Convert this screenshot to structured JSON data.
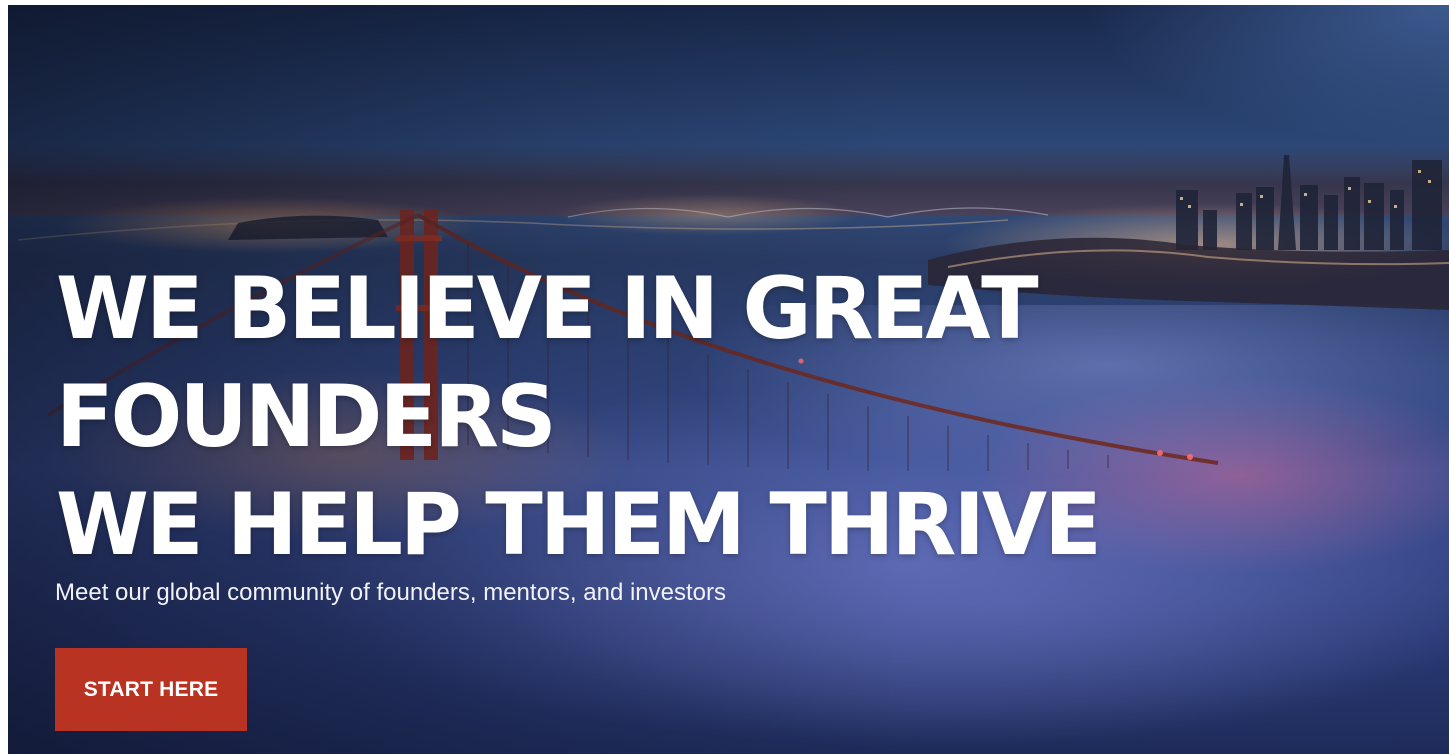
{
  "hero": {
    "headline_line1": "WE BELIEVE IN GREAT",
    "headline_line2": "FOUNDERS",
    "headline_line3": "WE HELP THEM THRIVE",
    "subtitle": "Meet our global community of founders, mentors, and investors",
    "cta_label": "START HERE"
  },
  "colors": {
    "cta_background": "#b83322",
    "headline_text": "#ffffff",
    "background_tone": "#2f447a"
  }
}
